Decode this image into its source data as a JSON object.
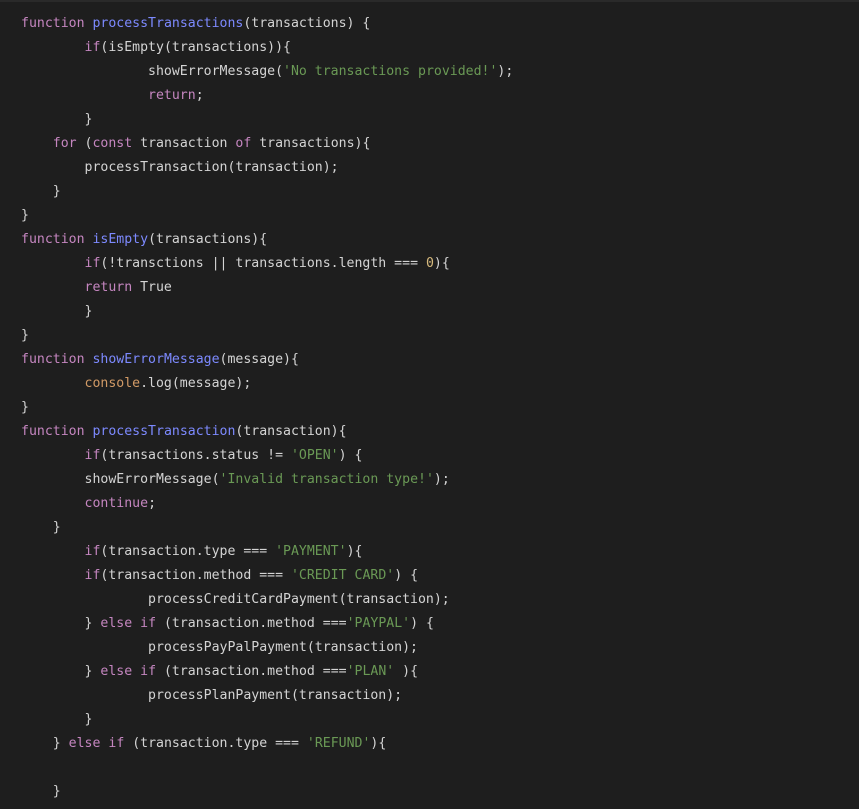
{
  "colors": {
    "background": "#1e1e1e",
    "plain": "#d4d4d4",
    "keyword": "#c586c0",
    "function_name": "#7d8aff",
    "string": "#6a9955",
    "number": "#d7ba7d",
    "builtin": "#d19a66"
  },
  "code": {
    "language": "javascript",
    "indent_unit": "    ",
    "lines": [
      {
        "indent": 0,
        "tokens": [
          {
            "t": "function",
            "k": "keyword"
          },
          {
            "t": " ",
            "k": "plain"
          },
          {
            "t": "processTransactions",
            "k": "function"
          },
          {
            "t": "(transactions) {",
            "k": "plain"
          }
        ]
      },
      {
        "indent": 2,
        "tokens": [
          {
            "t": "if",
            "k": "keyword"
          },
          {
            "t": "(isEmpty(transactions)){",
            "k": "plain"
          }
        ]
      },
      {
        "indent": 4,
        "tokens": [
          {
            "t": "showErrorMessage(",
            "k": "plain"
          },
          {
            "t": "'No transactions provided!'",
            "k": "string"
          },
          {
            "t": ");",
            "k": "plain"
          }
        ]
      },
      {
        "indent": 4,
        "tokens": [
          {
            "t": "return",
            "k": "keyword"
          },
          {
            "t": ";",
            "k": "plain"
          }
        ]
      },
      {
        "indent": 2,
        "tokens": [
          {
            "t": "}",
            "k": "plain"
          }
        ]
      },
      {
        "indent": 1,
        "tokens": [
          {
            "t": "for",
            "k": "keyword"
          },
          {
            "t": " (",
            "k": "plain"
          },
          {
            "t": "const",
            "k": "keyword"
          },
          {
            "t": " transaction ",
            "k": "plain"
          },
          {
            "t": "of",
            "k": "keyword"
          },
          {
            "t": " transactions){",
            "k": "plain"
          }
        ]
      },
      {
        "indent": 2,
        "tokens": [
          {
            "t": "processTransaction(transaction);",
            "k": "plain"
          }
        ]
      },
      {
        "indent": 1,
        "tokens": [
          {
            "t": "}",
            "k": "plain"
          }
        ]
      },
      {
        "indent": 0,
        "tokens": [
          {
            "t": "}",
            "k": "plain"
          }
        ]
      },
      {
        "indent": 0,
        "tokens": [
          {
            "t": "function",
            "k": "keyword"
          },
          {
            "t": " ",
            "k": "plain"
          },
          {
            "t": "isEmpty",
            "k": "function"
          },
          {
            "t": "(transactions){",
            "k": "plain"
          }
        ]
      },
      {
        "indent": 2,
        "tokens": [
          {
            "t": "if",
            "k": "keyword"
          },
          {
            "t": "(!transctions || transactions.length === ",
            "k": "plain"
          },
          {
            "t": "0",
            "k": "number"
          },
          {
            "t": "){",
            "k": "plain"
          }
        ]
      },
      {
        "indent": 2,
        "tokens": [
          {
            "t": "return",
            "k": "keyword"
          },
          {
            "t": " True",
            "k": "plain"
          }
        ]
      },
      {
        "indent": 2,
        "tokens": [
          {
            "t": "}",
            "k": "plain"
          }
        ]
      },
      {
        "indent": 0,
        "tokens": [
          {
            "t": "}",
            "k": "plain"
          }
        ]
      },
      {
        "indent": 0,
        "tokens": [
          {
            "t": "function",
            "k": "keyword"
          },
          {
            "t": " ",
            "k": "plain"
          },
          {
            "t": "showErrorMessage",
            "k": "function"
          },
          {
            "t": "(message){",
            "k": "plain"
          }
        ]
      },
      {
        "indent": 2,
        "tokens": [
          {
            "t": "console",
            "k": "builtin"
          },
          {
            "t": ".log(message);",
            "k": "plain"
          }
        ]
      },
      {
        "indent": 0,
        "tokens": [
          {
            "t": "}",
            "k": "plain"
          }
        ]
      },
      {
        "indent": 0,
        "tokens": [
          {
            "t": "function",
            "k": "keyword"
          },
          {
            "t": " ",
            "k": "plain"
          },
          {
            "t": "processTransaction",
            "k": "function"
          },
          {
            "t": "(transaction){",
            "k": "plain"
          }
        ]
      },
      {
        "indent": 2,
        "tokens": [
          {
            "t": "if",
            "k": "keyword"
          },
          {
            "t": "(transactions.status != ",
            "k": "plain"
          },
          {
            "t": "'OPEN'",
            "k": "string"
          },
          {
            "t": ") {",
            "k": "plain"
          }
        ]
      },
      {
        "indent": 2,
        "tokens": [
          {
            "t": "showErrorMessage(",
            "k": "plain"
          },
          {
            "t": "'Invalid transaction type!'",
            "k": "string"
          },
          {
            "t": ");",
            "k": "plain"
          }
        ]
      },
      {
        "indent": 2,
        "tokens": [
          {
            "t": "continue",
            "k": "keyword"
          },
          {
            "t": ";",
            "k": "plain"
          }
        ]
      },
      {
        "indent": 1,
        "tokens": [
          {
            "t": "}",
            "k": "plain"
          }
        ]
      },
      {
        "indent": 2,
        "tokens": [
          {
            "t": "if",
            "k": "keyword"
          },
          {
            "t": "(transaction.type === ",
            "k": "plain"
          },
          {
            "t": "'PAYMENT'",
            "k": "string"
          },
          {
            "t": "){",
            "k": "plain"
          }
        ]
      },
      {
        "indent": 2,
        "tokens": [
          {
            "t": "if",
            "k": "keyword"
          },
          {
            "t": "(transaction.method === ",
            "k": "plain"
          },
          {
            "t": "'CREDIT CARD'",
            "k": "string"
          },
          {
            "t": ") {",
            "k": "plain"
          }
        ]
      },
      {
        "indent": 4,
        "tokens": [
          {
            "t": "processCreditCardPayment(transaction);",
            "k": "plain"
          }
        ]
      },
      {
        "indent": 2,
        "tokens": [
          {
            "t": "} ",
            "k": "plain"
          },
          {
            "t": "else",
            "k": "keyword"
          },
          {
            "t": " ",
            "k": "plain"
          },
          {
            "t": "if",
            "k": "keyword"
          },
          {
            "t": " (transaction.method ===",
            "k": "plain"
          },
          {
            "t": "'PAYPAL'",
            "k": "string"
          },
          {
            "t": ") {",
            "k": "plain"
          }
        ]
      },
      {
        "indent": 4,
        "tokens": [
          {
            "t": "processPayPalPayment(transaction);",
            "k": "plain"
          }
        ]
      },
      {
        "indent": 2,
        "tokens": [
          {
            "t": "} ",
            "k": "plain"
          },
          {
            "t": "else",
            "k": "keyword"
          },
          {
            "t": " ",
            "k": "plain"
          },
          {
            "t": "if",
            "k": "keyword"
          },
          {
            "t": " (transaction.method ===",
            "k": "plain"
          },
          {
            "t": "'PLAN'",
            "k": "string"
          },
          {
            "t": " ){",
            "k": "plain"
          }
        ]
      },
      {
        "indent": 4,
        "tokens": [
          {
            "t": "processPlanPayment(transaction);",
            "k": "plain"
          }
        ]
      },
      {
        "indent": 2,
        "tokens": [
          {
            "t": "}",
            "k": "plain"
          }
        ]
      },
      {
        "indent": 1,
        "tokens": [
          {
            "t": "} ",
            "k": "plain"
          },
          {
            "t": "else",
            "k": "keyword"
          },
          {
            "t": " ",
            "k": "plain"
          },
          {
            "t": "if",
            "k": "keyword"
          },
          {
            "t": " (transaction.type === ",
            "k": "plain"
          },
          {
            "t": "'REFUND'",
            "k": "string"
          },
          {
            "t": "){",
            "k": "plain"
          }
        ]
      },
      {
        "indent": 0,
        "tokens": []
      },
      {
        "indent": 1,
        "tokens": [
          {
            "t": "}",
            "k": "plain"
          }
        ]
      }
    ]
  }
}
